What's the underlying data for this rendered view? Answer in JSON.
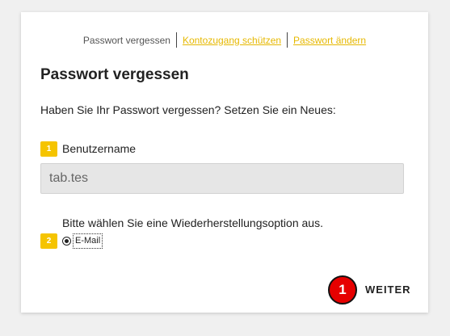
{
  "tabs": [
    {
      "label": "Passwort vergessen",
      "active": true
    },
    {
      "label": "Kontozugang schützen",
      "active": false
    },
    {
      "label": "Passwort ändern",
      "active": false
    }
  ],
  "main": {
    "title": "Passwort vergessen",
    "intro": "Haben Sie Ihr Passwort vergessen? Setzen Sie ein Neues:",
    "step1": {
      "number": "1",
      "label": "Benutzername",
      "input_value": "tab.tes"
    },
    "step2": {
      "number": "2",
      "label": "Bitte wählen Sie eine Wiederherstellungsoption aus.",
      "option_label": "E-Mail",
      "option_selected": true
    },
    "next_label": "WEITER",
    "marker_number": "1"
  },
  "colors": {
    "accent": "#f5c400",
    "link": "#e6b800",
    "marker": "#e60000"
  }
}
